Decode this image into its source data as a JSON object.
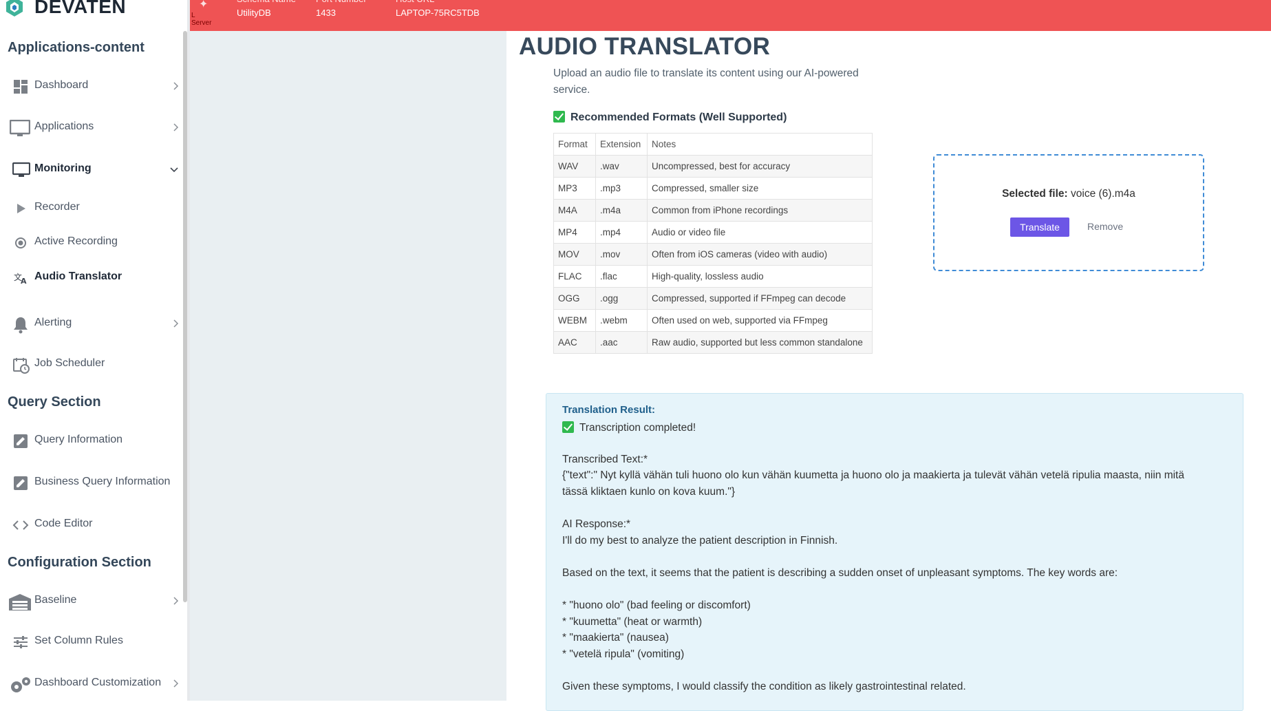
{
  "brand": {
    "name": "DEVATEN"
  },
  "topbar": {
    "server_label": "L Server",
    "fields": [
      {
        "key": "Schema Name",
        "value": "UtilityDB"
      },
      {
        "key": "Port Number",
        "value": "1433"
      },
      {
        "key": "Host URL",
        "value": "LAPTOP-75RC5TDB"
      }
    ]
  },
  "sidebar": {
    "sections": {
      "applications": "Applications-content",
      "query": "Query Section",
      "configuration": "Configuration Section"
    },
    "items": {
      "dashboard": "Dashboard",
      "applications": "Applications",
      "monitoring": "Monitoring",
      "recorder": "Recorder",
      "active_recording": "Active Recording",
      "audio_translator": "Audio Translator",
      "alerting": "Alerting",
      "job_scheduler": "Job Scheduler",
      "query_information": "Query Information",
      "business_query_information": "Business Query Information",
      "code_editor": "Code Editor",
      "baseline": "Baseline",
      "set_column_rules": "Set Column Rules",
      "dashboard_customization": "Dashboard Customization"
    }
  },
  "page": {
    "title": "AUDIO TRANSLATOR",
    "description": "Upload an audio file to translate its content using our AI-powered service.",
    "formats_heading": "Recommended Formats (Well Supported)"
  },
  "formats_table": {
    "headers": [
      "Format",
      "Extension",
      "Notes"
    ],
    "rows": [
      [
        "WAV",
        ".wav",
        "Uncompressed, best for accuracy"
      ],
      [
        "MP3",
        ".mp3",
        "Compressed, smaller size"
      ],
      [
        "M4A",
        ".m4a",
        "Common from iPhone recordings"
      ],
      [
        "MP4",
        ".mp4",
        "Audio or video file"
      ],
      [
        "MOV",
        ".mov",
        "Often from iOS cameras (video with audio)"
      ],
      [
        "FLAC",
        ".flac",
        "High-quality, lossless audio"
      ],
      [
        "OGG",
        ".ogg",
        "Compressed, supported if FFmpeg can decode"
      ],
      [
        "WEBM",
        ".webm",
        "Often used on web, supported via FFmpeg"
      ],
      [
        "AAC",
        ".aac",
        "Raw audio, supported but less common standalone"
      ]
    ]
  },
  "upload": {
    "selected_label": "Selected file:",
    "selected_file": "voice (6).m4a",
    "translate_label": "Translate",
    "remove_label": "Remove"
  },
  "result": {
    "title": "Translation Result:",
    "status": "Transcription completed!",
    "transcribed_label": "Transcribed Text:*",
    "transcribed_line1": "{\"text\":\" Nyt kyllä vähän tuli huono olo kun vähän kuumetta ja huono olo ja maakierta ja tulevät vähän vetelä ripulia maasta, niin mitä",
    "transcribed_line2": "tässä kliktaen kunlo on kova kuum.\"}",
    "ai_label": "AI Response:*",
    "ai_line1": "I'll do my best to analyze the patient description in Finnish.",
    "ai_line2": "Based on the text, it seems that the patient is describing a sudden onset of unpleasant symptoms. The key words are:",
    "bullets": [
      "* \"huono olo\" (bad feeling or discomfort)",
      "* \"kuumetta\" (heat or warmth)",
      "* \"maakierta\" (nausea)",
      "* \"vetelä ripula\" (vomiting)"
    ],
    "conclusion": "Given these symptoms, I would classify the condition as likely gastrointestinal related."
  },
  "colors": {
    "topbar": "#ef5354",
    "accent": "#6c56e6",
    "result_bg": "#e6f4fa",
    "upload_border": "#3f8bd6"
  }
}
